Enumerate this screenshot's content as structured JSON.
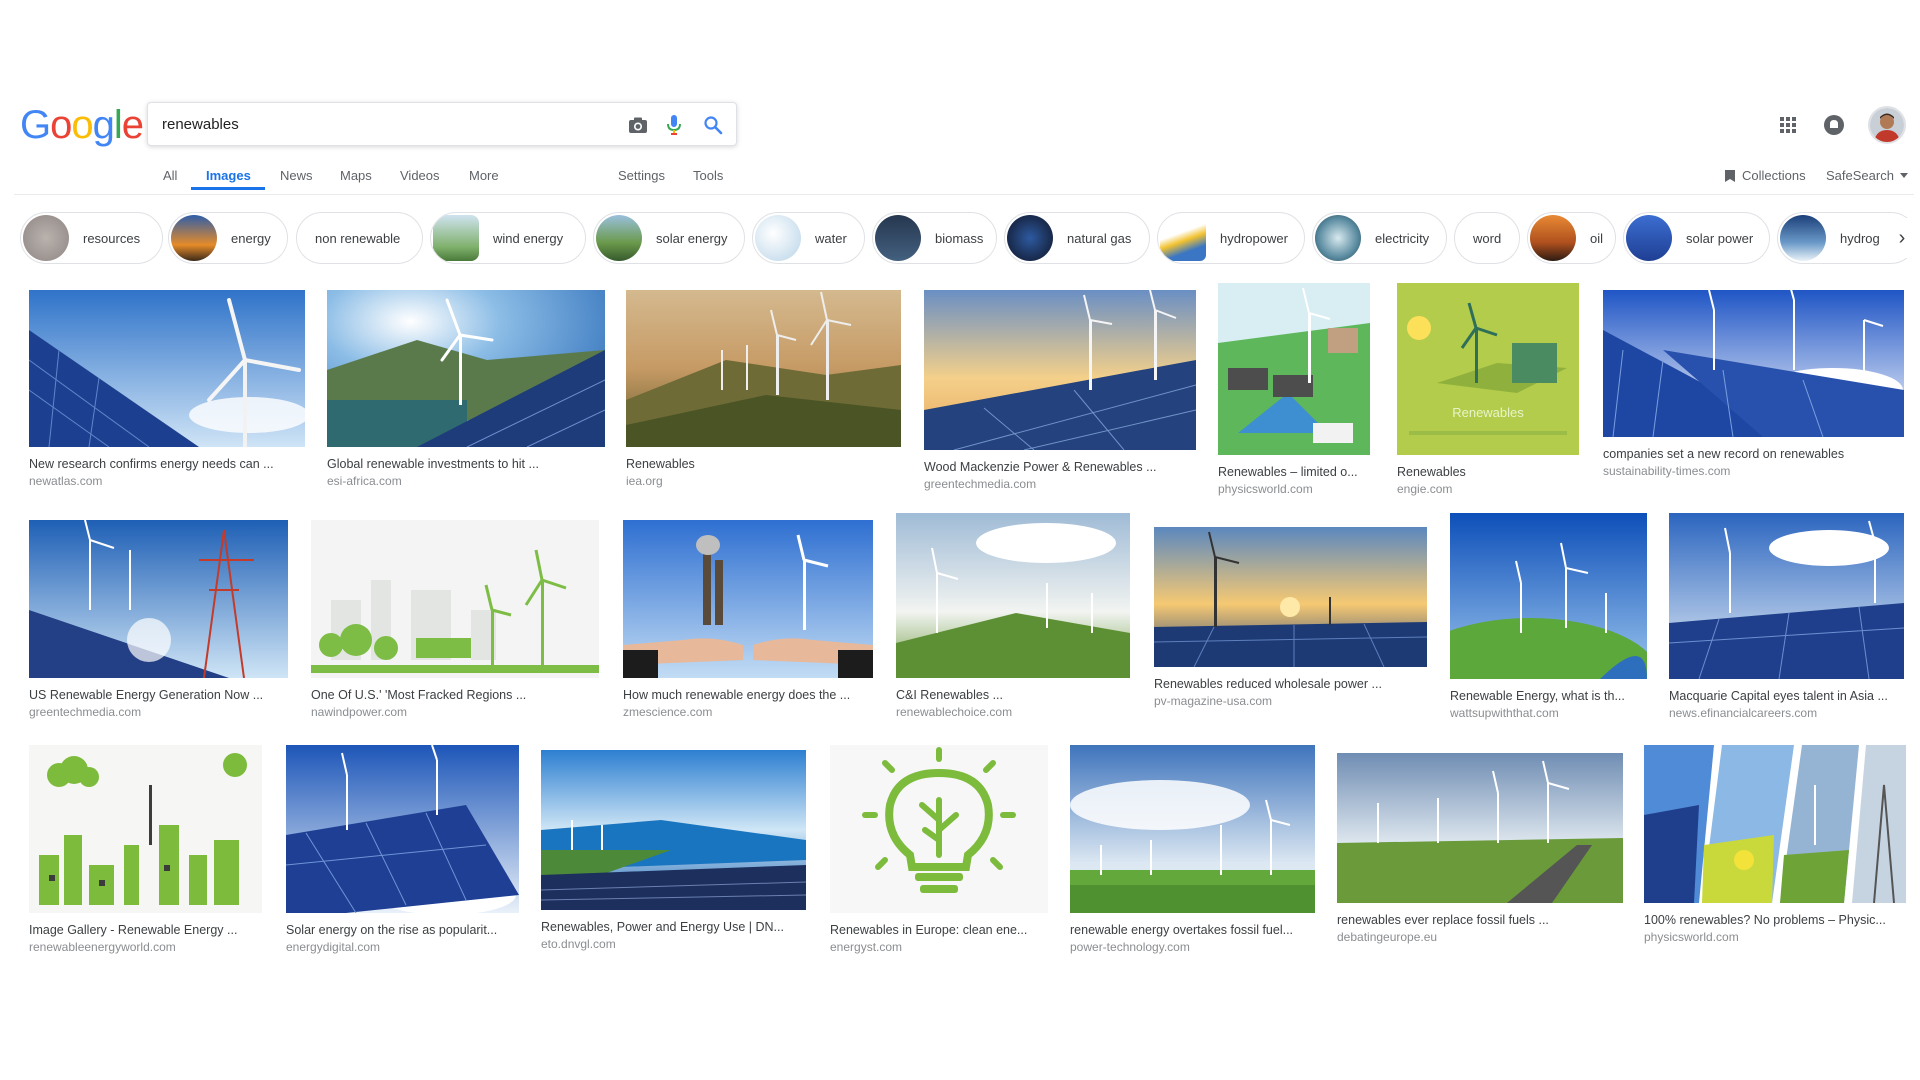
{
  "logo": [
    "G",
    "o",
    "o",
    "g",
    "l",
    "e"
  ],
  "logo_colors": [
    "#4285F4",
    "#EA4335",
    "#FBBC05",
    "#4285F4",
    "#34A853",
    "#EA4335"
  ],
  "search": {
    "query": "renewables"
  },
  "tabs": {
    "all": "All",
    "images": "Images",
    "news": "News",
    "maps": "Maps",
    "videos": "Videos",
    "more": "More",
    "settings": "Settings",
    "tools": "Tools"
  },
  "header_right": {
    "collections": "Collections",
    "safesearch": "SafeSearch"
  },
  "chips": [
    {
      "label": "resources"
    },
    {
      "label": "energy"
    },
    {
      "label": "non renewable"
    },
    {
      "label": "wind energy"
    },
    {
      "label": "solar energy"
    },
    {
      "label": "water"
    },
    {
      "label": "biomass"
    },
    {
      "label": "natural gas"
    },
    {
      "label": "hydropower"
    },
    {
      "label": "electricity"
    },
    {
      "label": "word"
    },
    {
      "label": "oil"
    },
    {
      "label": "solar power"
    },
    {
      "label": "hydrog"
    }
  ],
  "results": [
    {
      "title": "New research confirms energy needs can ...",
      "source": "newatlas.com"
    },
    {
      "title": "Global renewable investments to hit ...",
      "source": "esi-africa.com"
    },
    {
      "title": "Renewables",
      "source": "iea.org"
    },
    {
      "title": "Wood Mackenzie Power & Renewables ...",
      "source": "greentechmedia.com"
    },
    {
      "title": "Renewables – limited o...",
      "source": "physicsworld.com"
    },
    {
      "title": "Renewables",
      "source": "engie.com",
      "image_text": "Renewables"
    },
    {
      "title": "companies set a new record on renewables",
      "source": "sustainability-times.com"
    },
    {
      "title": "US Renewable Energy Generation Now ...",
      "source": "greentechmedia.com"
    },
    {
      "title": "One Of U.S.' 'Most Fracked Regions ...",
      "source": "nawindpower.com"
    },
    {
      "title": "How much renewable energy does the ...",
      "source": "zmescience.com"
    },
    {
      "title": "C&I Renewables ...",
      "source": "renewablechoice.com"
    },
    {
      "title": "Renewables reduced wholesale power ...",
      "source": "pv-magazine-usa.com"
    },
    {
      "title": "Renewable Energy, what is th...",
      "source": "wattsupwiththat.com"
    },
    {
      "title": "Macquarie Capital eyes talent in Asia ...",
      "source": "news.efinancialcareers.com"
    },
    {
      "title": "Image Gallery - Renewable Energy ...",
      "source": "renewableenergyworld.com"
    },
    {
      "title": "Solar energy on the rise as popularit...",
      "source": "energydigital.com"
    },
    {
      "title": "Renewables, Power and Energy Use | DN...",
      "source": "eto.dnvgl.com"
    },
    {
      "title": "Renewables in Europe: clean ene...",
      "source": "energyst.com"
    },
    {
      "title": "renewable energy overtakes fossil fuel...",
      "source": "power-technology.com"
    },
    {
      "title": "renewables ever replace fossil fuels ...",
      "source": "debatingeurope.eu"
    },
    {
      "title": "100% renewables? No problems – Physic...",
      "source": "physicsworld.com"
    }
  ],
  "colors": {
    "accent": "#1a73e8",
    "text": "#3c4043",
    "muted": "#8a8d91"
  }
}
